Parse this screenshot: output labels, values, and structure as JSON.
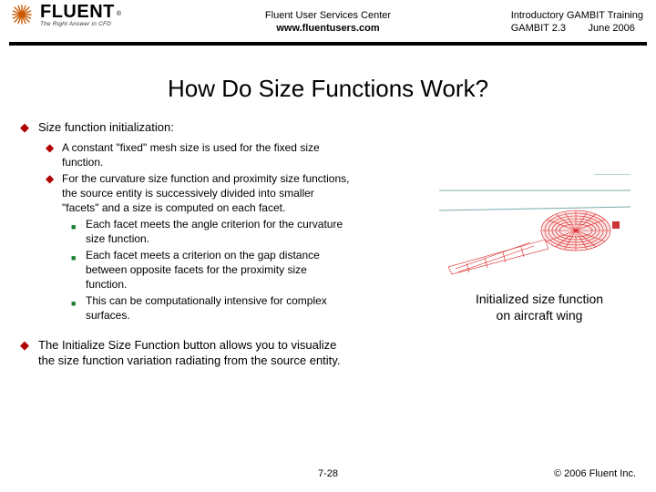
{
  "header": {
    "logo_text": "FLUENT",
    "logo_tag": "The Right Answer in CFD",
    "registered": "®",
    "center_line1": "Fluent User Services Center",
    "center_url": "www.fluentusers.com",
    "right_line1": "Introductory GAMBIT Training",
    "right_ver": "GAMBIT 2.3",
    "right_date": "June 2006"
  },
  "title": "How Do Size Functions Work?",
  "bullets": [
    {
      "text": "Size function initialization:",
      "children": [
        {
          "text": "A constant \"fixed\" mesh size is used for the fixed size function.",
          "children": []
        },
        {
          "text": "For the curvature size function and proximity size functions, the source entity is successively divided into smaller \"facets\" and a size is computed on each facet.",
          "children": [
            {
              "text": "Each facet meets the angle criterion for the curvature size function."
            },
            {
              "text": "Each facet meets a criterion on the gap distance between opposite facets for the proximity size function."
            },
            {
              "text": "This can be computationally intensive for complex surfaces."
            }
          ]
        }
      ]
    },
    {
      "text": "The Initialize Size Function button allows you to visualize the size function variation radiating from the source entity.",
      "children": []
    }
  ],
  "figure": {
    "caption_line1": "Initialized size function",
    "caption_line2": "on aircraft wing"
  },
  "footer": {
    "page": "7-28",
    "copyright": "© 2006 Fluent Inc."
  }
}
